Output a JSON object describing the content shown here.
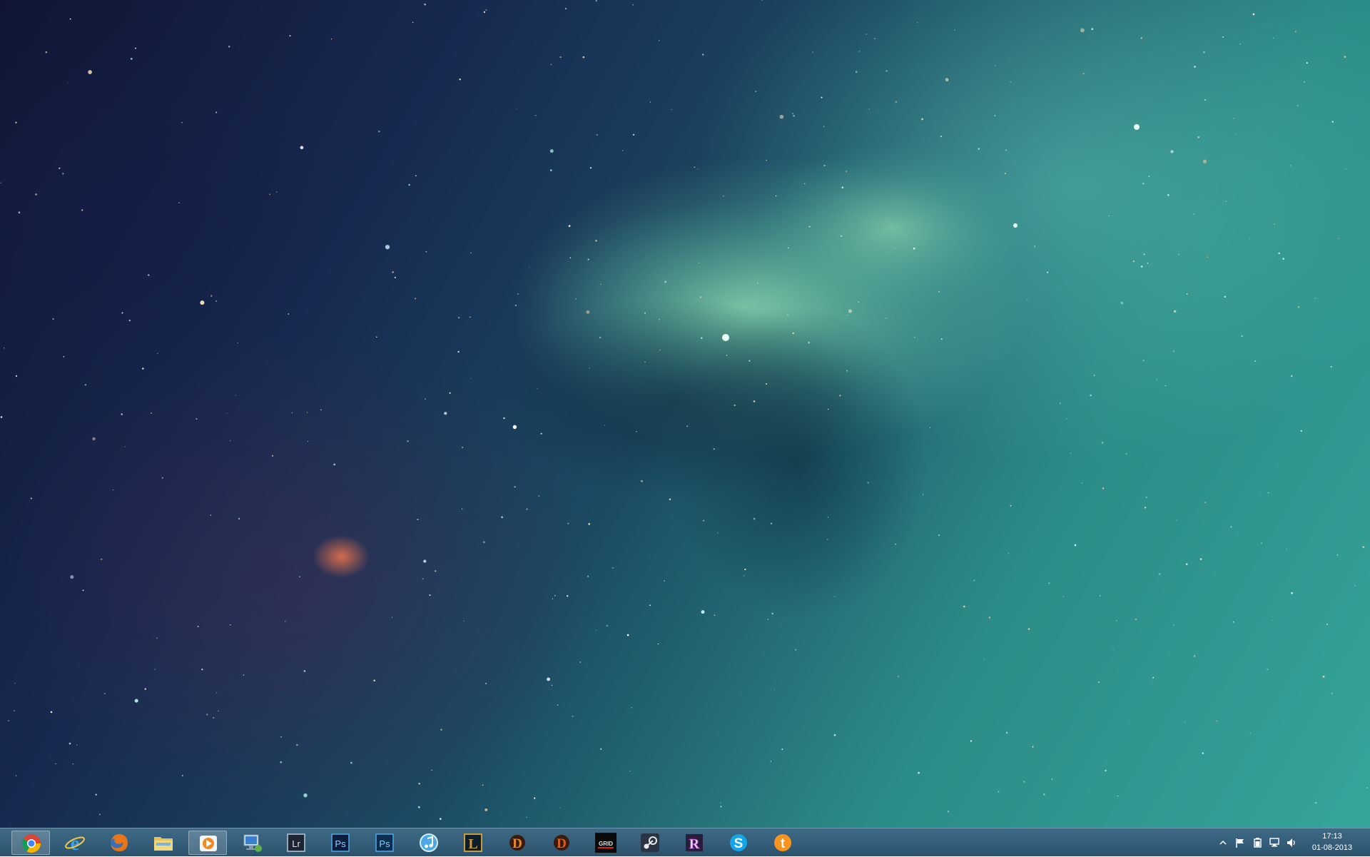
{
  "desktop": {
    "wallpaper": "space-nebula",
    "colors": {
      "deep": "#101534",
      "mid": "#1b4a63",
      "teal": "#35a69a",
      "glow": "#8ee0b4"
    }
  },
  "taskbar": {
    "background": "#2f5a75",
    "apps": [
      {
        "name": "chrome",
        "icon": "chrome-icon",
        "active": true
      },
      {
        "name": "internet-explorer",
        "icon": "internet-explorer-icon",
        "active": false
      },
      {
        "name": "firefox",
        "icon": "firefox-icon",
        "active": false
      },
      {
        "name": "file-explorer",
        "icon": "folder-icon",
        "active": false
      },
      {
        "name": "media-player",
        "icon": "media-player-icon",
        "active": true
      },
      {
        "name": "remote-desktop",
        "icon": "remote-desktop-icon",
        "active": false
      },
      {
        "name": "lightroom",
        "icon": "lightroom-icon",
        "label": "Lr",
        "active": false
      },
      {
        "name": "photoshop",
        "icon": "photoshop-icon",
        "label": "Ps",
        "active": false
      },
      {
        "name": "photoshop-2",
        "icon": "photoshop-icon",
        "label": "Ps",
        "active": false
      },
      {
        "name": "itunes",
        "icon": "itunes-icon",
        "active": false
      },
      {
        "name": "league-of-legends",
        "icon": "league-of-legends-icon",
        "label": "L",
        "active": false
      },
      {
        "name": "diablo-3",
        "icon": "diablo-icon",
        "label": "D",
        "active": false
      },
      {
        "name": "diablo-3-2",
        "icon": "diablo-icon",
        "label": "D",
        "active": false
      },
      {
        "name": "grid",
        "icon": "grid-game-icon",
        "label": "GRID",
        "active": false
      },
      {
        "name": "steam",
        "icon": "steam-icon",
        "active": false
      },
      {
        "name": "rift",
        "icon": "rift-icon",
        "label": "R",
        "active": false
      },
      {
        "name": "skype",
        "icon": "skype-icon",
        "label": "S",
        "active": false
      },
      {
        "name": "tumblr-app",
        "icon": "orange-t-icon",
        "label": "t",
        "active": false
      }
    ],
    "tray": {
      "icons": [
        "show-hidden-icons-chevron",
        "action-center-flag-icon",
        "power-icon",
        "network-icon",
        "volume-icon"
      ],
      "time": "17:13",
      "date": "01-08-2013"
    }
  }
}
